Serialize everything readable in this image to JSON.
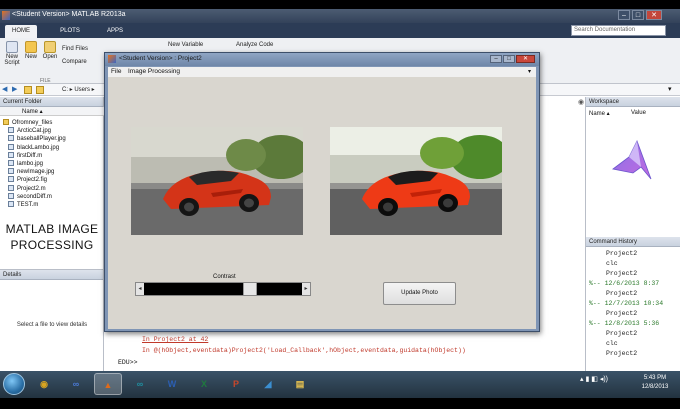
{
  "app": {
    "title": "<Student Version> MATLAB R2013a",
    "window_buttons": [
      "–",
      "□",
      "✕"
    ]
  },
  "ribbon_tabs": [
    "HOME",
    "PLOTS",
    "APPS"
  ],
  "search": {
    "placeholder": "Search Documentation"
  },
  "ribbon": {
    "new_script": "New\nScript",
    "new": "New",
    "open": "Open",
    "find_files": "Find Files",
    "compare": "Compare",
    "new_variable": "New Variable",
    "analyze_code": "Analyze Code",
    "section_file": "FILE"
  },
  "address": {
    "path": "C: ▸ Users ▸"
  },
  "current_folder": {
    "title": "Current Folder",
    "column": "Name ▴",
    "files": [
      {
        "name": "Ofromney_files",
        "type": "folder"
      },
      {
        "name": "ArcticCat.jpg",
        "type": "file"
      },
      {
        "name": "baseballPlayer.jpg",
        "type": "file"
      },
      {
        "name": "blackLambo.jpg",
        "type": "file"
      },
      {
        "name": "firstDiff.m",
        "type": "file"
      },
      {
        "name": "lambo.jpg",
        "type": "file"
      },
      {
        "name": "newImage.jpg",
        "type": "file"
      },
      {
        "name": "Project2.fig",
        "type": "file"
      },
      {
        "name": "Project2.m",
        "type": "file"
      },
      {
        "name": "secondDiff.m",
        "type": "file"
      },
      {
        "name": "TEST.m",
        "type": "file"
      }
    ],
    "caption_line1": "MATLAB IMAGE",
    "caption_line2": "PROCESSING"
  },
  "details": {
    "title": "Details",
    "message": "Select a file to view details"
  },
  "command_window": {
    "lines": [
      "In Project2 at 42",
      "In @(hObject,eventdata)Project2('Load_Callback',hObject,eventdata,guidata(hObject))",
      "EDU>>"
    ]
  },
  "workspace": {
    "title": "Workspace",
    "col_name": "Name ▴",
    "col_value": "Value"
  },
  "history": {
    "title": "Command History",
    "lines": [
      {
        "text": "Project2",
        "sep": false
      },
      {
        "text": "clc",
        "sep": false
      },
      {
        "text": "Project2",
        "sep": false
      },
      {
        "text": "%-- 12/6/2013 8:37",
        "sep": true
      },
      {
        "text": "Project2",
        "sep": false
      },
      {
        "text": "%-- 12/7/2013 10:34",
        "sep": true
      },
      {
        "text": "Project2",
        "sep": false
      },
      {
        "text": "%-- 12/8/2013 5:36",
        "sep": true
      },
      {
        "text": "Project2",
        "sep": false
      },
      {
        "text": "clc",
        "sep": false
      },
      {
        "text": "Project2",
        "sep": false
      }
    ]
  },
  "figure": {
    "title": "<Student Version> : Project2",
    "menu": [
      "File",
      "Image Processing"
    ],
    "slider_label": "Contrast",
    "slider_value": 0.69,
    "update_button": "Update Photo"
  },
  "taskbar": {
    "apps": [
      {
        "name": "chrome",
        "glyph": "◉",
        "color": "#d9a520"
      },
      {
        "name": "infinity",
        "glyph": "∞",
        "color": "#4a7ad6"
      },
      {
        "name": "matlab",
        "glyph": "▲",
        "color": "#e06a1a"
      },
      {
        "name": "arduino",
        "glyph": "∞",
        "color": "#1f8fa0"
      },
      {
        "name": "word",
        "glyph": "W",
        "color": "#2b5fb4"
      },
      {
        "name": "excel",
        "glyph": "X",
        "color": "#1f7a3e"
      },
      {
        "name": "powerpoint",
        "glyph": "P",
        "color": "#c8472a"
      },
      {
        "name": "app",
        "glyph": "◢",
        "color": "#3b8fd1"
      },
      {
        "name": "explorer",
        "glyph": "▤",
        "color": "#e8c350"
      }
    ],
    "time": "5:43 PM",
    "date": "12/8/2013"
  }
}
